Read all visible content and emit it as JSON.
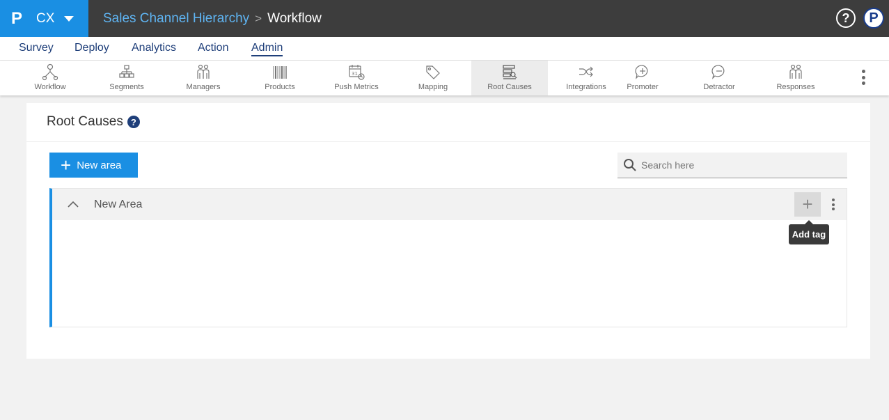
{
  "brand": {
    "logo": "P",
    "name": "CX"
  },
  "breadcrumb": {
    "parent": "Sales Channel Hierarchy",
    "separator": ">",
    "current": "Workflow"
  },
  "topbar": {
    "help_symbol": "?",
    "user_symbol": "P"
  },
  "main_nav": [
    "Survey",
    "Deploy",
    "Analytics",
    "Action",
    "Admin"
  ],
  "active_main_nav": "Admin",
  "sub_nav": [
    {
      "label": "Workflow",
      "icon": "workflow-icon"
    },
    {
      "label": "Segments",
      "icon": "segments-icon"
    },
    {
      "label": "Managers",
      "icon": "managers-icon"
    },
    {
      "label": "Products",
      "icon": "barcode-icon"
    },
    {
      "label": "Push Metrics",
      "icon": "calendar-icon"
    },
    {
      "label": "Mapping",
      "icon": "tag-icon"
    },
    {
      "label": "Root Causes",
      "icon": "root-causes-icon"
    },
    {
      "label": "Integrations",
      "icon": "shuffle-icon"
    },
    {
      "label": "Promoter",
      "icon": "chat-plus-icon"
    },
    {
      "label": "Detractor",
      "icon": "chat-minus-icon"
    },
    {
      "label": "Responses",
      "icon": "people-icon"
    }
  ],
  "active_sub_nav": "Root Causes",
  "page": {
    "title": "Root Causes",
    "help_symbol": "?",
    "new_area_label": "New area",
    "search_placeholder": "Search here"
  },
  "areas": [
    {
      "name": "New Area",
      "expanded": true
    }
  ],
  "tooltip": "Add tag",
  "colors": {
    "accent": "#1a8fe3",
    "topbar": "#3d3d3d",
    "nav_text": "#1f3f7a"
  }
}
